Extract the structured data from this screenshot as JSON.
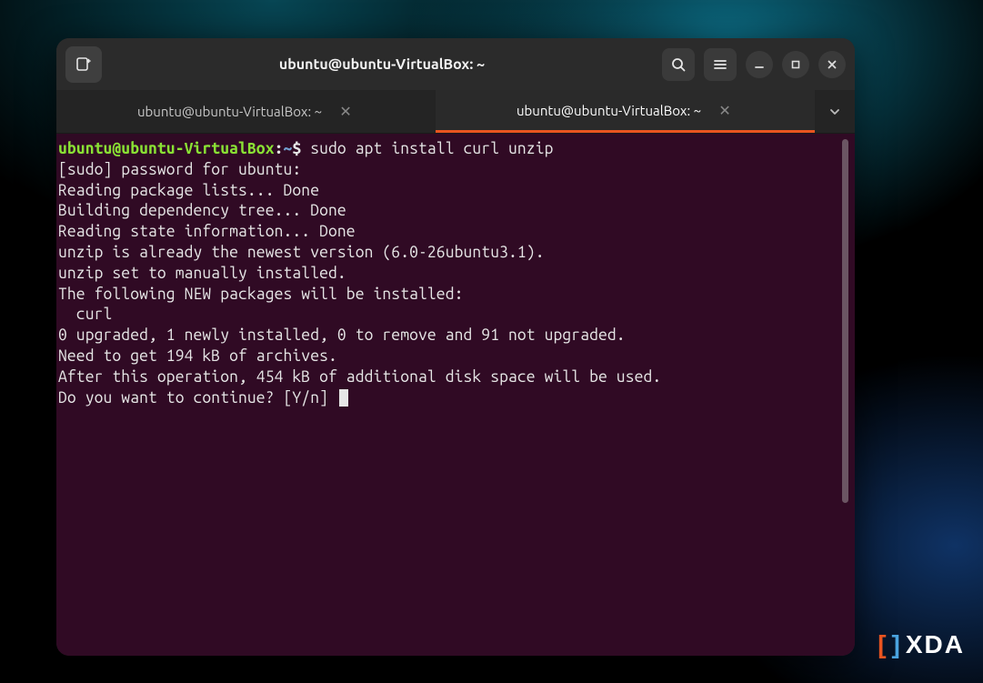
{
  "window": {
    "title": "ubuntu@ubuntu-VirtualBox: ~"
  },
  "tabs": [
    {
      "label": "ubuntu@ubuntu-VirtualBox: ~",
      "active": false
    },
    {
      "label": "ubuntu@ubuntu-VirtualBox: ~",
      "active": true
    }
  ],
  "prompt": {
    "userhost": "ubuntu@ubuntu-VirtualBox",
    "colon": ":",
    "path": "~",
    "dollar": "$ ",
    "command": "sudo apt install curl unzip"
  },
  "output": {
    "l01": "[sudo] password for ubuntu:",
    "l02": "Reading package lists... Done",
    "l03": "Building dependency tree... Done",
    "l04": "Reading state information... Done",
    "l05": "unzip is already the newest version (6.0-26ubuntu3.1).",
    "l06": "unzip set to manually installed.",
    "l07": "The following NEW packages will be installed:",
    "l08": "  curl",
    "l09": "0 upgraded, 1 newly installed, 0 to remove and 91 not upgraded.",
    "l10": "Need to get 194 kB of archives.",
    "l11": "After this operation, 454 kB of additional disk space will be used.",
    "l12": "Do you want to continue? [Y/n] "
  },
  "watermark": {
    "text": "XDA"
  }
}
